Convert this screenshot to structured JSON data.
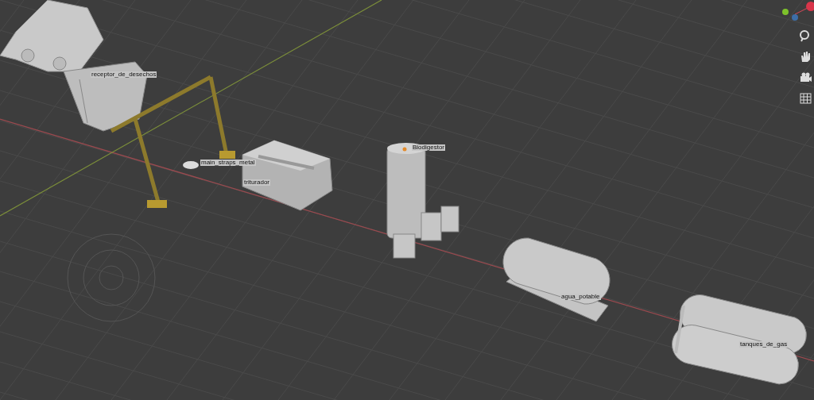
{
  "viewport": {
    "objects": [
      {
        "kind": "truck"
      },
      {
        "kind": "hopper",
        "label": "receptor_de_desechos"
      },
      {
        "kind": "crane"
      },
      {
        "kind": "plate",
        "label": "main_straps_metal"
      },
      {
        "kind": "crusher",
        "label": "triturador"
      },
      {
        "kind": "digester",
        "label": "Biodigestor"
      },
      {
        "kind": "water_tank",
        "label": "agua_potable"
      },
      {
        "kind": "gas_tanks",
        "label": "tanques_de_gas"
      }
    ]
  },
  "navigation": {
    "tools": [
      {
        "kind": "zoom"
      },
      {
        "kind": "pan"
      },
      {
        "kind": "camera"
      },
      {
        "kind": "grid"
      }
    ]
  }
}
